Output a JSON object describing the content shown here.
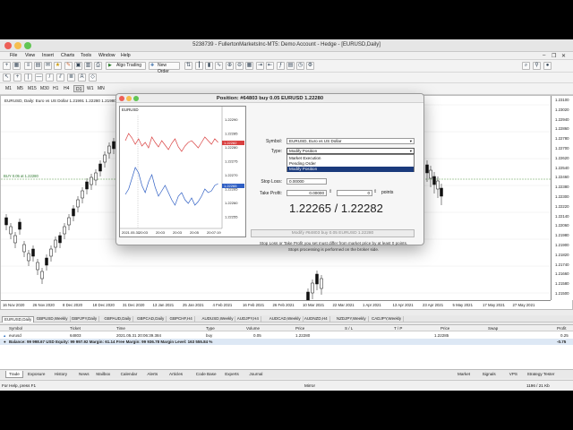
{
  "window": {
    "title": "5238739 - FullertonMarketsInc-MT5: Demo Account - Hedge - [EURUSD,Daily]"
  },
  "menubar": {
    "items": [
      "File",
      "View",
      "Insert",
      "Charts",
      "Tools",
      "Window",
      "Help"
    ]
  },
  "toolbar": {
    "algo_trading": "Algo Trading",
    "new_order": "New Order"
  },
  "timeframes": [
    "M1",
    "M5",
    "M15",
    "M30",
    "H1",
    "H4",
    "D1",
    "W1",
    "MN"
  ],
  "timeframe_selected": "D1",
  "chart": {
    "label": "EURUSD, Daily: Euro vs US Dollar 1.21991 1.22280 1.21980 1.22286",
    "order_line": "BUY 0.05 at 1.22280",
    "price_labels": [
      "1.23100",
      "1.23020",
      "1.22940",
      "1.22860",
      "1.22780",
      "1.22700",
      "1.22620",
      "1.22540",
      "1.22460",
      "1.22380",
      "1.22300",
      "1.22220",
      "1.22140",
      "1.22060",
      "1.21980",
      "1.21900",
      "1.21820",
      "1.21740",
      "1.21660",
      "1.21580",
      "1.21500"
    ],
    "date_labels": [
      "16 Nov 2020",
      "26 Nov 2020",
      "8 Dec 2020",
      "18 Dec 2020",
      "31 Dec 2020",
      "13 Jan 2021",
      "25 Jan 2021",
      "4 Feb 2021",
      "16 Feb 2021",
      "26 Feb 2021",
      "10 Mar 2021",
      "22 Mar 2021",
      "1 Apr 2021",
      "13 Apr 2021",
      "23 Apr 2021",
      "5 May 2021",
      "17 May 2021",
      "27 May 2021"
    ],
    "colors": {
      "up": "#1a1a1a",
      "down": "#1a1a1a",
      "order_line": "#5a9e4a",
      "grid": "#e8e8e8"
    }
  },
  "chart_tabs": [
    "EURUSD,Daily",
    "GBPUSD,Weekly",
    "GBPJPY,Daily",
    "GBPAUD,Daily",
    "GBPCAD,Daily",
    "GBPCHF,H4",
    "AUDUSD,Weekly",
    "AUDJPY,H4",
    "AUDCAD,Weekly",
    "AUDNZD,H4",
    "NZDJPY,Weekly",
    "CADJPY,Weekly"
  ],
  "terminal": {
    "headers": [
      "Symbol",
      "Ticket",
      "Time",
      "Type",
      "Volume",
      "Price",
      "S / L",
      "T / P",
      "Price",
      "Swap",
      "Profit"
    ],
    "row": [
      "eurusd",
      "64803",
      "2021.05.31 20:06:39.384",
      "buy",
      "0.05",
      "1.22280",
      "",
      "",
      "1.22285",
      "",
      "0.25"
    ],
    "balance": "Balance: 99 998.67 USD  Equity: 99 997.92  Margin: 61.14  Free Margin: 99 936.78  Margin Level: 163 555.84 %",
    "balance_profit": "-0.75"
  },
  "terminal_tabs": [
    "Trade",
    "Exposure",
    "History",
    "News",
    "Mailbox",
    "Calendar",
    "Alerts",
    "Articles",
    "Code Base",
    "Experts",
    "Journal"
  ],
  "terminal_tabs_right": [
    "Market",
    "Signals",
    "VPS",
    "Strategy Tester"
  ],
  "status": {
    "help": "For Help, press F1",
    "profile": "Mirror",
    "traffic": "1196 / 21 Kb"
  },
  "dialog": {
    "title": "Position: #64803 buy 0.05 EURUSD 1.22280",
    "symbol_label": "Symbol:",
    "symbol_value": "EURUSD, Euro vs US Dollar",
    "type_label": "Type:",
    "type_value": "Modify Position",
    "type_options": [
      "Market Execution",
      "Pending Order",
      "Modify Position"
    ],
    "sl_label": "Stop Loss:",
    "sl_value": "0.00000",
    "tp_label": "Take Profit:",
    "tp_value": "0.00000",
    "points_value": "0",
    "points_label": "points",
    "bid": "1.22265",
    "ask": "1.22282",
    "price_sep": " / ",
    "modify_button": "Modify #64803 buy 0.05 EURUSD 1.22280",
    "note1": "Stop Loss or Take Profit you set must differ from market price by at least 0 points.",
    "note2": "Stops processing is performed on the broker side.",
    "tick_chart": {
      "label": "EURUSD",
      "price_labels": [
        "1.22290",
        "1.22285",
        "1.22280",
        "1.22275",
        "1.22270",
        "1.22265",
        "1.22260",
        "1.22255"
      ],
      "ask_tag": "1.22282",
      "bid_tag": "1.22265",
      "time_labels": [
        "2021.05.31",
        "20:03",
        "20:03",
        "20:03",
        "20:05",
        "20:07:19"
      ],
      "colors": {
        "ask": "#d94040",
        "bid": "#2f5fc4"
      }
    }
  }
}
